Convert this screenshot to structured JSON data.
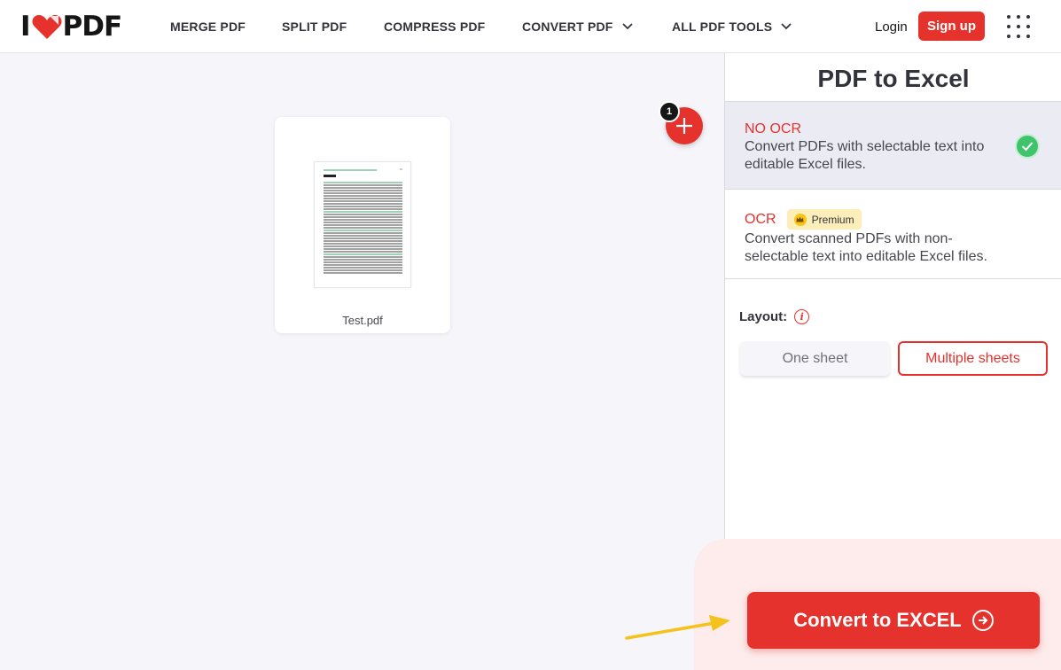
{
  "header": {
    "logo": "I PDF",
    "nav": [
      {
        "label": "MERGE PDF"
      },
      {
        "label": "SPLIT PDF"
      },
      {
        "label": "COMPRESS PDF"
      },
      {
        "label": "CONVERT PDF"
      },
      {
        "label": "ALL PDF TOOLS"
      }
    ],
    "login": "Login",
    "signup": "Sign up"
  },
  "workspace": {
    "file_name": "Test.pdf",
    "file_count": "1"
  },
  "sidebar": {
    "title": "PDF to Excel",
    "options": [
      {
        "title": "NO OCR",
        "description": "Convert PDFs with selectable text into editable Excel files.",
        "selected": true
      },
      {
        "title": "OCR",
        "badge": "Premium",
        "description": "Convert scanned PDFs with non-selectable text into editable Excel files.",
        "selected": false
      }
    ],
    "layout_label": "Layout:",
    "layout_options": [
      {
        "label": "One sheet",
        "selected": false
      },
      {
        "label": "Multiple sheets",
        "selected": true
      }
    ],
    "convert_label": "Convert to EXCEL"
  },
  "colors": {
    "brand_red": "#e5322d",
    "success_green": "#3fc46b",
    "premium_bg": "#fbeeb8",
    "annotation_arrow": "#f5c21b"
  }
}
